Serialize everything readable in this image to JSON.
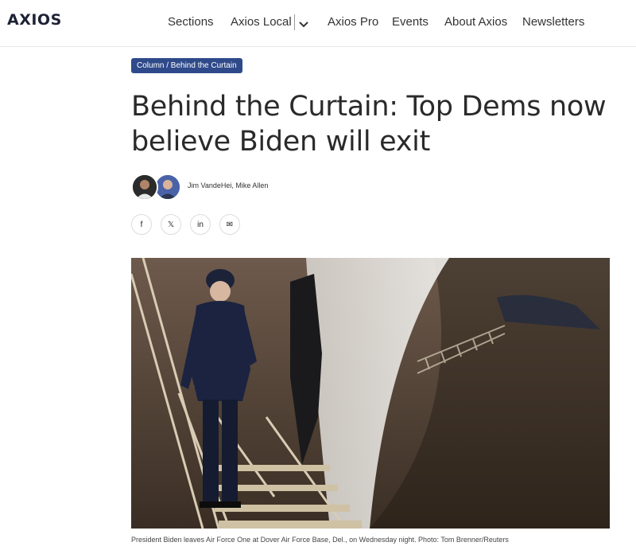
{
  "header": {
    "logo": "AXIOS",
    "nav": [
      {
        "label": "Sections"
      },
      {
        "label": "Axios Local"
      },
      {
        "label": "Axios Pro"
      },
      {
        "label": "Events"
      },
      {
        "label": "About Axios"
      },
      {
        "label": "Newsletters"
      }
    ]
  },
  "article": {
    "tag": "Column / Behind the Curtain",
    "headline": "Behind the Curtain: Top Dems now believe Biden will exit",
    "authors": "Jim VandeHei, Mike Allen",
    "share": [
      {
        "label": "f",
        "icon": "facebook-icon"
      },
      {
        "label": "𝕏",
        "icon": "x-icon"
      },
      {
        "label": "in",
        "icon": "linkedin-icon"
      },
      {
        "label": "✉",
        "icon": "email-icon"
      }
    ],
    "photo_caption": "President Biden leaves Air Force One at Dover Air Force Base, Del., on Wednesday night. Photo: Tom Brenner/Reuters"
  },
  "colors": {
    "brand": "#1e2236",
    "tag_bg": "#2f4a8a"
  }
}
